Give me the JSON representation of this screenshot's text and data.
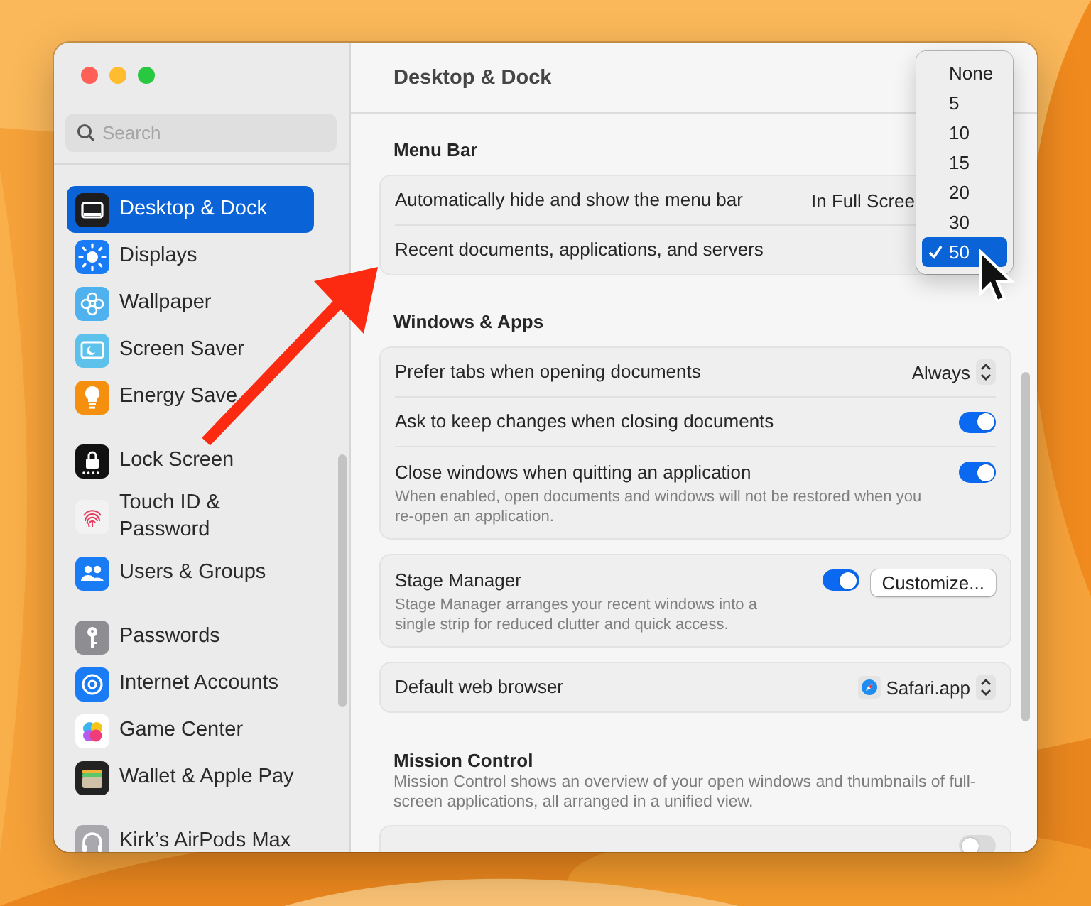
{
  "sidebar": {
    "search": {
      "placeholder": "Search"
    },
    "groups": [
      {
        "items": [
          {
            "label": "Desktop & Dock",
            "selected": true
          },
          {
            "label": "Displays",
            "selected": false
          },
          {
            "label": "Wallpaper",
            "selected": false
          },
          {
            "label": "Screen Saver",
            "selected": false
          },
          {
            "label": "Energy Save",
            "selected": false
          }
        ]
      },
      {
        "items": [
          {
            "label": "Lock Screen",
            "selected": false
          },
          {
            "label": "Touch ID & Password",
            "selected": false
          },
          {
            "label": "Users & Groups",
            "selected": false
          }
        ]
      },
      {
        "items": [
          {
            "label": "Passwords",
            "selected": false
          },
          {
            "label": "Internet Accounts",
            "selected": false
          },
          {
            "label": "Game Center",
            "selected": false
          },
          {
            "label": "Wallet & Apple Pay",
            "selected": false
          }
        ]
      },
      {
        "items": [
          {
            "label": "Kirk’s AirPods Max",
            "selected": false
          }
        ]
      }
    ]
  },
  "pane": {
    "title": "Desktop & Dock",
    "sections": [
      {
        "heading": "Menu Bar",
        "cards": [
          {
            "rows": [
              {
                "kind": "value",
                "label": "Automatically hide and show the menu bar",
                "value": "In Full Scree"
              },
              {
                "kind": "plain",
                "label": "Recent documents, applications, and servers"
              }
            ]
          }
        ]
      },
      {
        "heading": "Windows & Apps",
        "cards": [
          {
            "rows": [
              {
                "kind": "popup",
                "label": "Prefer tabs when opening documents",
                "value": "Always"
              },
              {
                "kind": "toggle",
                "label": "Ask to keep changes when closing documents",
                "on": true
              },
              {
                "kind": "toggle",
                "label": "Close windows when quitting an application",
                "description": "When enabled, open documents and windows will not be restored when you re-open an application.",
                "on": true
              }
            ]
          },
          {
            "rows": [
              {
                "kind": "toggle_button",
                "label": "Stage Manager",
                "description": "Stage Manager arranges your recent windows into a single strip for reduced clutter and quick access.",
                "on": true,
                "button": "Customize..."
              }
            ]
          },
          {
            "rows": [
              {
                "kind": "app_popup",
                "label": "Default web browser",
                "value": "Safari.app"
              }
            ]
          }
        ]
      },
      {
        "heading": "Mission Control",
        "description": "Mission Control shows an overview of your open windows and thumbnails of full-screen applications, all arranged in a unified view.",
        "cards": [
          {
            "rows": [
              {
                "kind": "toggle",
                "on": false
              }
            ]
          }
        ]
      }
    ]
  },
  "popup_menu": {
    "options": [
      {
        "label": "None",
        "selected": false
      },
      {
        "label": "5",
        "selected": false
      },
      {
        "label": "10",
        "selected": false
      },
      {
        "label": "15",
        "selected": false
      },
      {
        "label": "20",
        "selected": false
      },
      {
        "label": "30",
        "selected": false
      },
      {
        "label": "50",
        "selected": true
      }
    ]
  }
}
